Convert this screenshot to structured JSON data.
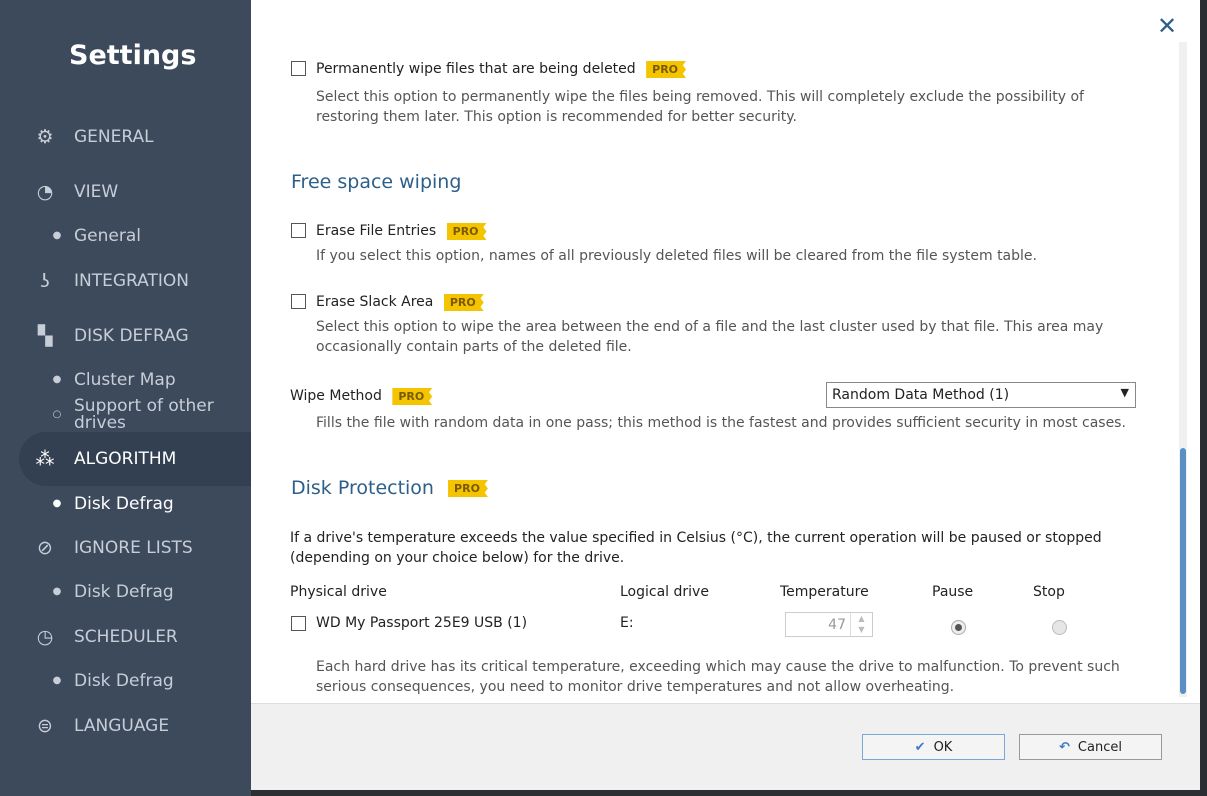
{
  "sidebar": {
    "title": "Settings",
    "items": [
      {
        "label": "GENERAL",
        "icon": "gear-icon"
      },
      {
        "label": "VIEW",
        "icon": "view-icon"
      },
      {
        "label": "General"
      },
      {
        "label": "INTEGRATION",
        "icon": "integration-icon"
      },
      {
        "label": "DISK DEFRAG",
        "icon": "disk-defrag-icon"
      },
      {
        "label": "Cluster Map"
      },
      {
        "label": "Support of other drives"
      },
      {
        "label": "ALGORITHM",
        "icon": "algorithm-icon"
      },
      {
        "label": "Disk Defrag"
      },
      {
        "label": "IGNORE LISTS",
        "icon": "ignore-icon"
      },
      {
        "label": "Disk Defrag"
      },
      {
        "label": "SCHEDULER",
        "icon": "clock-icon"
      },
      {
        "label": "Disk Defrag"
      },
      {
        "label": "LANGUAGE",
        "icon": "language-icon"
      }
    ]
  },
  "pro": "PRO",
  "wipe": {
    "label": "Permanently wipe files that are being deleted",
    "desc": "Select this option to permanently wipe the files being removed. This will completely exclude the possibility of restoring them later. This option is recommended for better security."
  },
  "free": {
    "heading": "Free space wiping",
    "erase_entries": {
      "label": "Erase File Entries",
      "desc": "If you select this option, names of all previously deleted files will be cleared from the file system table."
    },
    "erase_slack": {
      "label": "Erase Slack Area",
      "desc": "Select this option to wipe the area between the end of a file and the last cluster used by that file. This area may occasionally contain parts of the deleted file."
    },
    "method": {
      "label": "Wipe Method",
      "value": "Random Data Method (1)",
      "desc": "Fills the file with random data in one pass; this method is the fastest and provides sufficient security in most cases."
    }
  },
  "protection": {
    "heading": "Disk Protection",
    "desc": "If a drive's temperature exceeds the value specified in Celsius (°C), the current operation will be paused or stopped (depending on your choice below) for the drive.",
    "columns": [
      "Physical drive",
      "Logical drive",
      "Temperature",
      "Pause",
      "Stop"
    ],
    "drive": {
      "name": "WD My Passport 25E9 USB (1)",
      "logical": "E:",
      "temperature": "47",
      "action": "Pause"
    },
    "note": "Each hard drive has its critical temperature, exceeding which may cause the drive to malfunction. To prevent such serious consequences, you need to monitor drive temperatures and not allow overheating."
  },
  "footer": {
    "ok": "OK",
    "cancel": "Cancel"
  }
}
